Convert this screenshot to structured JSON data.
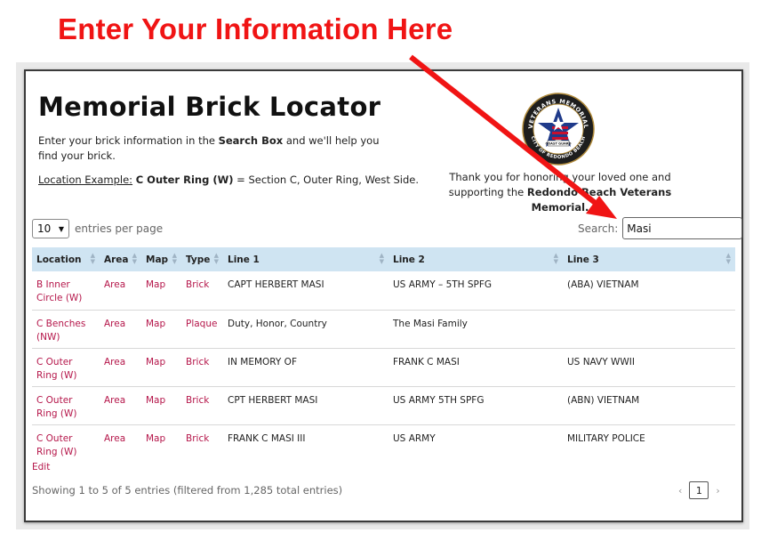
{
  "callout": "Enter Your Information Here",
  "header": {
    "title": "Memorial Brick Locator",
    "intro_pre": "Enter your brick information in the ",
    "intro_bold": "Search Box",
    "intro_post": " and we'll help you find your brick.",
    "example_label": "Location Example:",
    "example_bold": "C Outer Ring (W)",
    "example_rest": " = Section C, Outer Ring, West Side.",
    "thanks_pre": "Thank you for honoring your loved one and supporting the ",
    "thanks_bold": "Redondo Beach Veterans Memorial."
  },
  "logo": {
    "arc_top": "VETERANS MEMORIAL",
    "arc_bottom": "CITY OF REDONDO BEACH",
    "banner": "COAST GUARD"
  },
  "controls": {
    "length_value": "10",
    "length_label": "entries per page",
    "search_label": "Search:",
    "search_value": "Masi"
  },
  "table": {
    "columns": [
      "Location",
      "Area",
      "Map",
      "Type",
      "Line 1",
      "Line 2",
      "Line 3"
    ],
    "rows": [
      [
        "B Inner Circle (W)",
        "Area",
        "Map",
        "Brick",
        "CAPT HERBERT MASI",
        "US ARMY – 5TH SPFG",
        "(ABA) VIETNAM"
      ],
      [
        "C Benches (NW)",
        "Area",
        "Map",
        "Plaque",
        "Duty, Honor, Country",
        "The Masi Family",
        ""
      ],
      [
        "C Outer Ring (W)",
        "Area",
        "Map",
        "Brick",
        "IN MEMORY OF",
        "FRANK C MASI",
        "US NAVY WWII"
      ],
      [
        "C Outer Ring (W)",
        "Area",
        "Map",
        "Brick",
        "CPT HERBERT MASI",
        "US ARMY 5TH SPFG",
        "(ABN) VIETNAM"
      ],
      [
        "C Outer Ring (W)",
        "Area",
        "Map",
        "Brick",
        "FRANK C MASI III",
        "US ARMY",
        "MILITARY POLICE"
      ]
    ]
  },
  "footer": {
    "edit": "Edit",
    "info": "Showing 1 to 5 of 5 entries (filtered from 1,285 total entries)",
    "prev": "‹",
    "page": "1",
    "next": "›"
  },
  "colors": {
    "callout": "#f01414",
    "link": "#b5164a",
    "header_bg": "#cfe4f2"
  }
}
